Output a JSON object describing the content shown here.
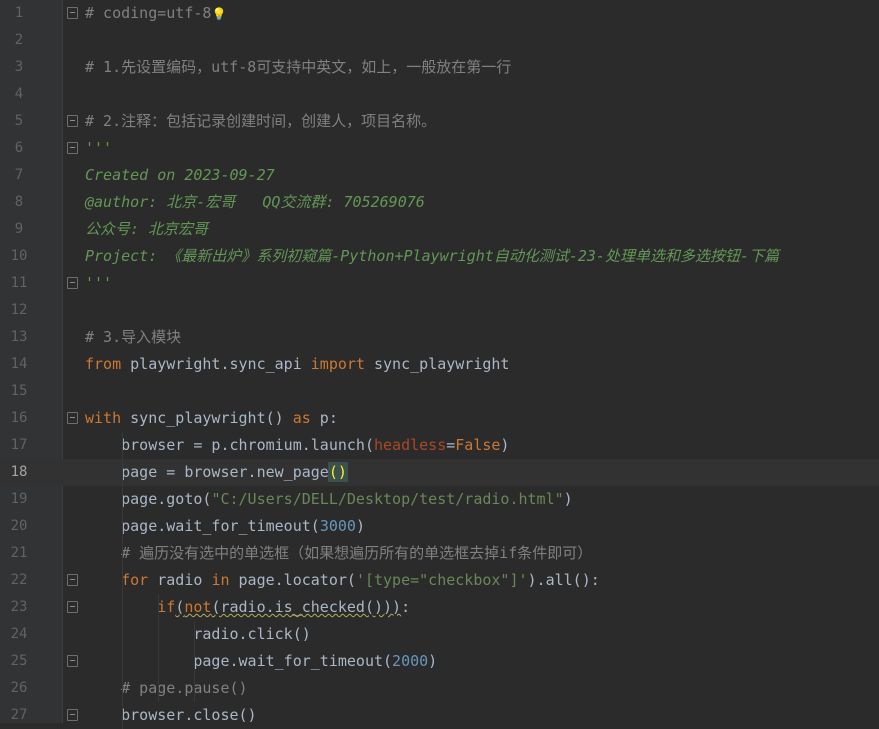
{
  "lines": [
    {
      "n": "1",
      "parts": [
        {
          "t": "# coding=utf-8",
          "c": "cm"
        }
      ]
    },
    {
      "n": "2",
      "parts": []
    },
    {
      "n": "3",
      "parts": [
        {
          "t": "# 1.先设置编码，utf-8可支持中英文，如上，一般放在第一行",
          "c": "cm"
        }
      ]
    },
    {
      "n": "4",
      "parts": []
    },
    {
      "n": "5",
      "parts": [
        {
          "t": "# 2.注释：包括记录创建时间，创建人，项目名称。",
          "c": "cm"
        }
      ]
    },
    {
      "n": "6",
      "parts": [
        {
          "t": "'''",
          "c": "doc"
        }
      ]
    },
    {
      "n": "7",
      "parts": [
        {
          "t": "Created on 2023-09-27",
          "c": "doc"
        }
      ]
    },
    {
      "n": "8",
      "parts": [
        {
          "t": "@author: 北京-宏哥   QQ交流群: 705269076",
          "c": "doc"
        }
      ]
    },
    {
      "n": "9",
      "parts": [
        {
          "t": "公众号: 北京宏哥",
          "c": "doc"
        }
      ]
    },
    {
      "n": "10",
      "parts": [
        {
          "t": "Project: 《最新出炉》系列初窥篇-Python+Playwright自动化测试-23-处理单选和多选按钮-下篇",
          "c": "doc"
        }
      ]
    },
    {
      "n": "11",
      "parts": [
        {
          "t": "'''",
          "c": "doc"
        }
      ]
    },
    {
      "n": "12",
      "parts": []
    },
    {
      "n": "13",
      "parts": [
        {
          "t": "# 3.导入模块",
          "c": "cm"
        }
      ]
    },
    {
      "n": "14",
      "parts": [
        {
          "t": "from",
          "c": "kw"
        },
        {
          "t": " playwright.sync_api ",
          "c": ""
        },
        {
          "t": "import",
          "c": "kw"
        },
        {
          "t": " sync_playwright",
          "c": ""
        }
      ]
    },
    {
      "n": "15",
      "parts": []
    },
    {
      "n": "16",
      "parts": [
        {
          "t": "with",
          "c": "kw"
        },
        {
          "t": " sync_playwright() ",
          "c": ""
        },
        {
          "t": "as",
          "c": "kw"
        },
        {
          "t": " p:",
          "c": ""
        }
      ]
    },
    {
      "n": "17",
      "parts": [
        {
          "t": "    browser = p.chromium.launch(",
          "c": ""
        },
        {
          "t": "headless",
          "c": "param"
        },
        {
          "t": "=",
          "c": ""
        },
        {
          "t": "False",
          "c": "kw"
        },
        {
          "t": ")",
          "c": ""
        }
      ]
    },
    {
      "n": "18",
      "parts": [
        {
          "t": "    page = browser.new_page",
          "c": ""
        },
        {
          "t": "()",
          "c": "paren-hl"
        }
      ]
    },
    {
      "n": "19",
      "parts": [
        {
          "t": "    page.goto(",
          "c": ""
        },
        {
          "t": "\"C:/Users/DELL/Desktop/test/radio.html\"",
          "c": "str"
        },
        {
          "t": ")",
          "c": ""
        }
      ]
    },
    {
      "n": "20",
      "parts": [
        {
          "t": "    page.wait_for_timeout(",
          "c": ""
        },
        {
          "t": "3000",
          "c": "num"
        },
        {
          "t": ")",
          "c": ""
        }
      ]
    },
    {
      "n": "21",
      "parts": [
        {
          "t": "    # 遍历没有选中的单选框（如果想遍历所有的单选框去掉if条件即可）",
          "c": "cm"
        }
      ]
    },
    {
      "n": "22",
      "parts": [
        {
          "t": "    ",
          "c": ""
        },
        {
          "t": "for",
          "c": "kw"
        },
        {
          "t": " radio ",
          "c": ""
        },
        {
          "t": "in",
          "c": "kw"
        },
        {
          "t": " page.locator(",
          "c": ""
        },
        {
          "t": "'[type=\"checkbox\"]'",
          "c": "str"
        },
        {
          "t": ").all():",
          "c": ""
        }
      ]
    },
    {
      "n": "23",
      "parts": [
        {
          "t": "        ",
          "c": ""
        },
        {
          "t": "if",
          "c": "kw"
        },
        {
          "t": "(",
          "c": "squiggle"
        },
        {
          "t": "not",
          "c": "kw squiggle"
        },
        {
          "t": "(radio.is_checked()))",
          "c": "squiggle"
        },
        {
          "t": ":",
          "c": ""
        }
      ]
    },
    {
      "n": "24",
      "parts": [
        {
          "t": "            radio.click()",
          "c": ""
        }
      ]
    },
    {
      "n": "25",
      "parts": [
        {
          "t": "            page.wait_for_timeout(",
          "c": ""
        },
        {
          "t": "2000",
          "c": "num"
        },
        {
          "t": ")",
          "c": ""
        }
      ]
    },
    {
      "n": "26",
      "parts": [
        {
          "t": "    # page.pause()",
          "c": "cm"
        }
      ]
    },
    {
      "n": "27",
      "parts": [
        {
          "t": "    browser.close()",
          "c": ""
        }
      ]
    }
  ],
  "current_line": "18",
  "fold_lines": [
    "1",
    "5",
    "6",
    "11",
    "16",
    "22",
    "23",
    "25",
    "27"
  ],
  "colors": {
    "background": "#2b2b2b",
    "comment": "#808080",
    "docstring": "#629755",
    "keyword": "#cc7832",
    "string": "#6a8759",
    "number": "#6897bb"
  },
  "icons": {
    "hint": "bulb-icon"
  }
}
